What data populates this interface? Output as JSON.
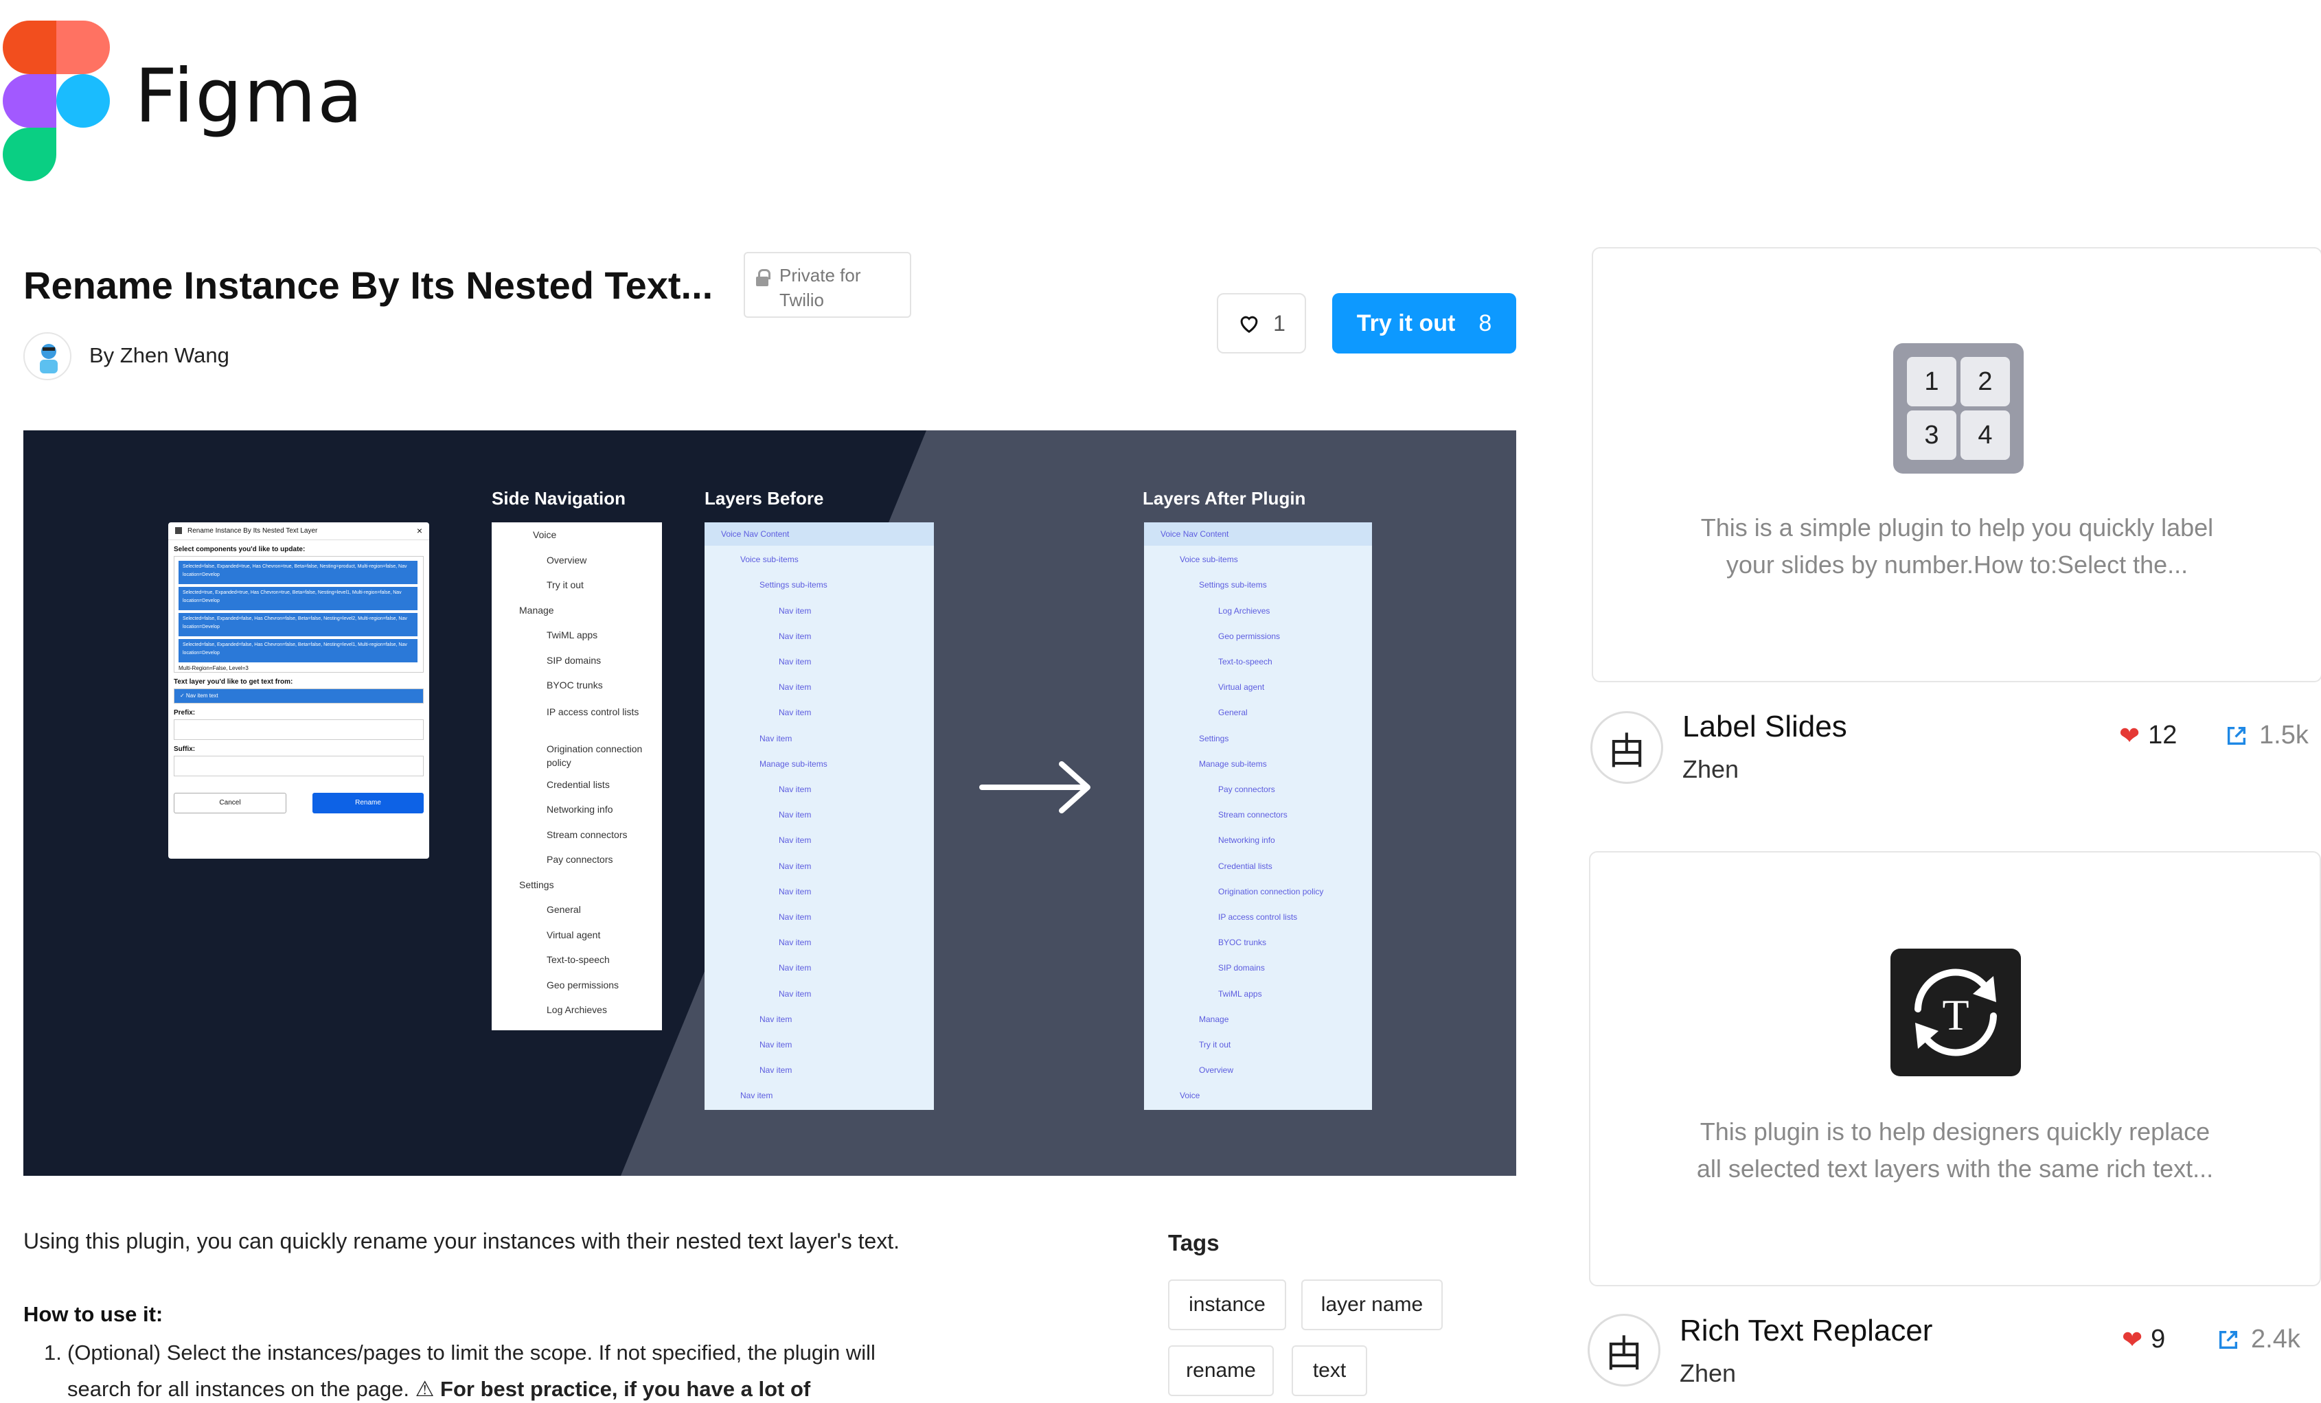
{
  "header": {
    "brand": "Figma"
  },
  "plugin": {
    "title": "Rename Instance By Its Nested Text...",
    "private_badge": "Private for Twilio",
    "author": "By Zhen Wang",
    "likes": "1",
    "try_label": "Try it out",
    "try_count": "8"
  },
  "hero": {
    "dialog": {
      "title": "Rename Instance By Its Nested Text Layer",
      "select_label": "Select components you'd like to update:",
      "items": [
        "Selected=false, Expanded=true, Has Chevron=true, Beta=false, Nesting=product, Multi-region=false, Nav location=Develop",
        "Selected=true, Expanded=true, Has Chevron=true, Beta=false, Nesting=level1, Multi-region=false, Nav location=Develop",
        "Selected=false, Expanded=false, Has Chevron=false, Beta=false, Nesting=level2, Multi-region=false, Nav location=Develop",
        "Selected=false, Expanded=false, Has Chevron=false, Beta=false, Nesting=level1, Multi-region=false, Nav location=Develop"
      ],
      "list_footer": "Multi-Region=False, Level=3",
      "text_layer_label": "Text layer you'd like to get text from:",
      "text_layer_value": "✓ Nav item text",
      "prefix_label": "Prefix:",
      "suffix_label": "Suffix:",
      "cancel": "Cancel",
      "rename": "Rename"
    },
    "side_nav": {
      "title": "Side Navigation",
      "items": [
        "Voice",
        "Overview",
        "Try it out",
        "Manage",
        "TwiML apps",
        "SIP domains",
        "BYOC trunks",
        "IP access control lists",
        "Origination connection policy",
        "Credential lists",
        "Networking info",
        "Stream connectors",
        "Pay connectors",
        "Settings",
        "General",
        "Virtual agent",
        "Text-to-speech",
        "Geo permissions",
        "Log Archieves"
      ]
    },
    "layers_before": {
      "title": "Layers Before",
      "items": [
        "Voice Nav Content",
        "Voice sub-items",
        "Settings sub-items",
        "Nav item",
        "Nav item",
        "Nav item",
        "Nav item",
        "Nav item",
        "Nav item",
        "Manage sub-items",
        "Nav item",
        "Nav item",
        "Nav item",
        "Nav item",
        "Nav item",
        "Nav item",
        "Nav item",
        "Nav item",
        "Nav item",
        "Nav item",
        "Nav item",
        "Nav item",
        "Nav item"
      ]
    },
    "layers_after": {
      "title": "Layers After Plugin",
      "items": [
        "Voice Nav Content",
        "Voice sub-items",
        "Settings sub-items",
        "Log Archieves",
        "Geo permissions",
        "Text-to-speech",
        "Virtual agent",
        "General",
        "Settings",
        "Manage sub-items",
        "Pay connectors",
        "Stream connectors",
        "Networking info",
        "Credential lists",
        "Origination connection policy",
        "IP access control lists",
        "BYOC trunks",
        "SIP domains",
        "TwiML apps",
        "Manage",
        "Try it out",
        "Overview",
        "Voice"
      ]
    }
  },
  "description": {
    "intro": "Using this plugin, you can quickly rename your instances with their nested text layer's text.",
    "howto_title": "How to use it:",
    "step1_num": "1.",
    "step1_line1": "(Optional) Select the instances/pages to limit the scope. If not specified, the plugin will",
    "step1_line2_a": "search for all instances on the page. ",
    "step1_line2_b": "⚠ For best practice, if you have a lot of"
  },
  "tags": {
    "title": "Tags",
    "items": [
      "instance",
      "layer name",
      "rename",
      "text"
    ]
  },
  "related": [
    {
      "description_line1": "This is a simple plugin to help you quickly label",
      "description_line2": "your slides by number.How to:Select the...",
      "icon_numbers": [
        "1",
        "2",
        "3",
        "4"
      ],
      "title": "Label Slides",
      "author": "Zhen",
      "likes": "12",
      "uses": "1.5k",
      "avatar_glyph": "甴"
    },
    {
      "description_line1": "This plugin is to help designers quickly replace",
      "description_line2": "all selected text layers with the same rich text...",
      "title": "Rich Text Replacer",
      "author": "Zhen",
      "likes": "9",
      "uses": "2.4k",
      "avatar_glyph": "甴"
    }
  ],
  "colors": {
    "accent": "#0d99ff",
    "hero_dark": "#141c2e",
    "hero_light": "#474e60",
    "heart": "#e53935"
  }
}
